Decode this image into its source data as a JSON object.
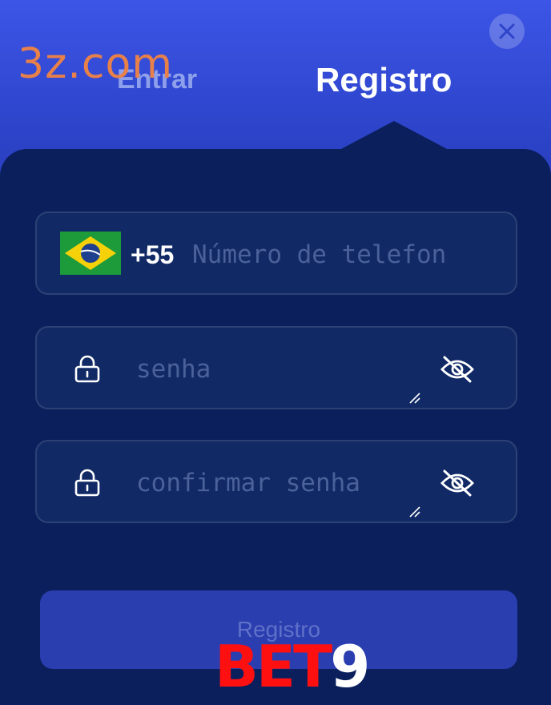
{
  "watermark": "3z.com",
  "tabs": {
    "login_label": "Entrar",
    "register_label": "Registro"
  },
  "close_icon": "close-icon",
  "phone": {
    "country_flag": "brazil-flag",
    "prefix": "+55",
    "placeholder": "Número de telefon",
    "value": ""
  },
  "password": {
    "placeholder": "senha",
    "value": "",
    "icon": "lock-icon",
    "toggle_icon": "eye-off-icon"
  },
  "confirm_password": {
    "placeholder": "confirmar senha",
    "value": "",
    "icon": "lock-icon",
    "toggle_icon": "eye-off-icon"
  },
  "submit_label": "Registro",
  "brand": {
    "part1": "BET",
    "part2": "9"
  },
  "colors": {
    "header_gradient_top": "#3d55e6",
    "panel_bg": "#0a1f5c",
    "field_bg": "#112a66",
    "button_bg": "#2a3eb0",
    "brand_red": "#ff1010"
  }
}
